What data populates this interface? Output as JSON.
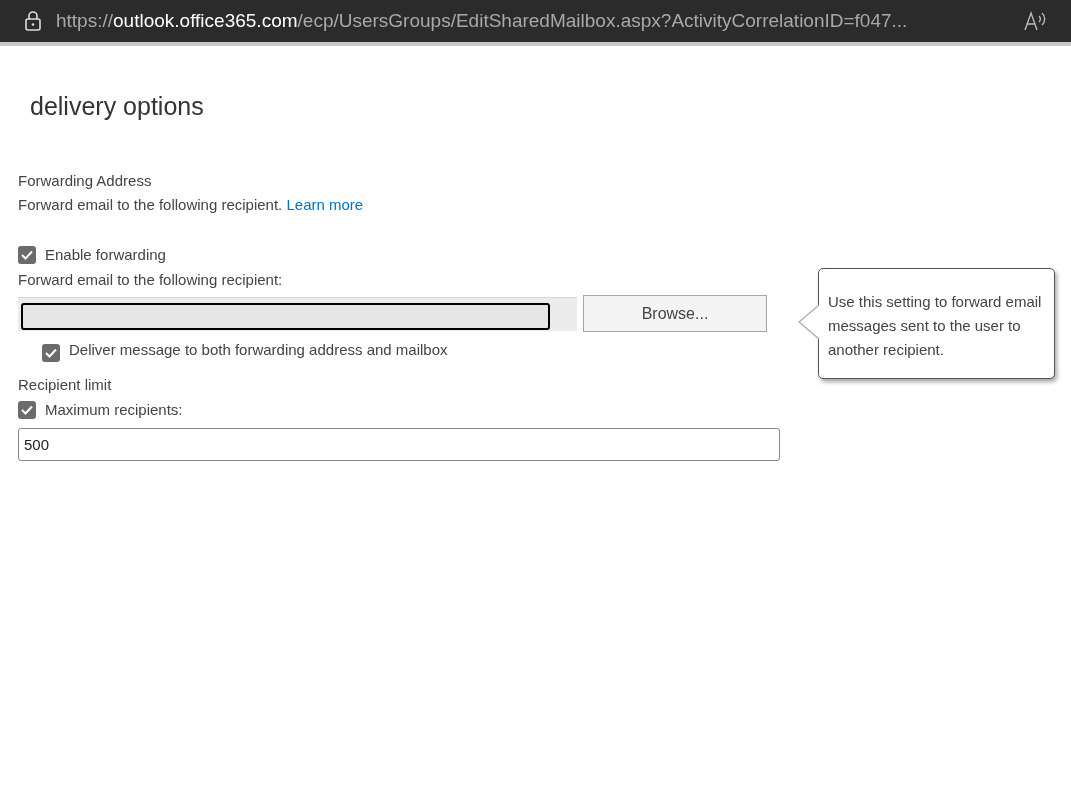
{
  "address_bar": {
    "scheme": "https://",
    "host": "outlook.office365.com",
    "path": "/ecp/UsersGroups/EditSharedMailbox.aspx?ActivityCorrelationID=f047..."
  },
  "page_title": "delivery options",
  "forwarding": {
    "heading": "Forwarding Address",
    "description": "Forward email to the following recipient.",
    "link": "Learn more",
    "enable": {
      "label": "Enable forwarding",
      "checked": true
    },
    "recipient_label": "Forward email to the following recipient:",
    "browse_button": "Browse...",
    "deliver_both": {
      "label": "Deliver message to both forwarding address and mailbox",
      "checked": true
    }
  },
  "recipient_limit": {
    "heading": "Recipient limit",
    "maximum": {
      "label": "Maximum recipients:",
      "checked": true
    },
    "value": "500"
  },
  "tooltip": {
    "text": "Use this setting to forward email messages sent to the user to another recipient."
  }
}
